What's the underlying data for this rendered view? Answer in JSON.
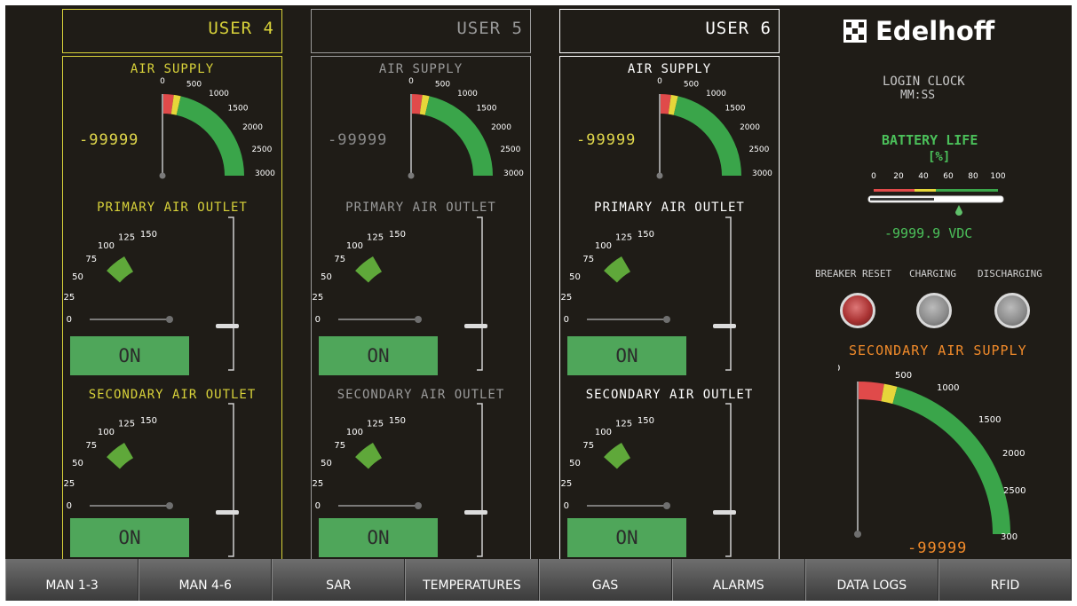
{
  "users": [
    {
      "label": "USER 4",
      "air_supply_title": "AIR SUPPLY",
      "air_value": "-99999",
      "primary_title": "PRIMARY AIR OUTLET",
      "primary_button": "ON",
      "secondary_title": "SECONDARY AIR OUTLET",
      "secondary_button": "ON",
      "accent": "#d8d23a"
    },
    {
      "label": "USER 5",
      "air_supply_title": "AIR SUPPLY",
      "air_value": "-99999",
      "primary_title": "PRIMARY AIR OUTLET",
      "primary_button": "ON",
      "secondary_title": "SECONDARY AIR OUTLET",
      "secondary_button": "ON",
      "accent": "#9a9a9a"
    },
    {
      "label": "USER 6",
      "air_supply_title": "AIR SUPPLY",
      "air_value": "-99999",
      "primary_title": "PRIMARY AIR OUTLET",
      "primary_button": "ON",
      "secondary_title": "SECONDARY AIR OUTLET",
      "secondary_button": "ON",
      "accent": "#ffffff"
    }
  ],
  "air_gauge_ticks": [
    "0",
    "500",
    "1000",
    "1500",
    "2000",
    "2500",
    "3000"
  ],
  "outlet_gauge_ticks": [
    "0",
    "25",
    "50",
    "75",
    "100",
    "125",
    "150"
  ],
  "brand": {
    "name": "Edelhoff",
    "icon": "checker-logo-icon"
  },
  "login_clock": {
    "label": "LOGIN CLOCK",
    "value": "MM:SS"
  },
  "battery": {
    "title": "BATTERY LIFE",
    "unit": "[%]",
    "ticks": [
      "0",
      "20",
      "40",
      "60",
      "80",
      "100"
    ],
    "voltage": "-9999.9 VDC"
  },
  "indicators": [
    {
      "label": "BREAKER RESET",
      "state": "red"
    },
    {
      "label": "CHARGING",
      "state": "off"
    },
    {
      "label": "DISCHARGING",
      "state": "off"
    }
  ],
  "secondary_supply": {
    "title": "SECONDARY AIR SUPPLY",
    "ticks": [
      "0",
      "500",
      "1000",
      "1500",
      "2000",
      "2500",
      "300"
    ],
    "value": "-99999"
  },
  "nav": [
    "MAN 1-3",
    "MAN 4-6",
    "SAR",
    "TEMPERATURES",
    "GAS",
    "ALARMS",
    "DATA LOGS",
    "RFID"
  ],
  "colors": {
    "background": "#1f1c17",
    "gauge_green": "#3aa54a",
    "gauge_yellow": "#e6d63a",
    "gauge_red": "#e04a4a",
    "value_yellow": "#e1d84c",
    "value_orange": "#f08a2a",
    "battery_green": "#4bc05a"
  }
}
